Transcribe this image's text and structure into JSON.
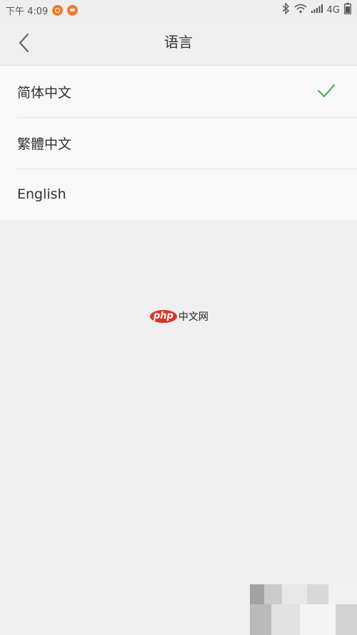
{
  "status_bar": {
    "time": "下午 4:09",
    "network": "4G",
    "icons": [
      "notification-icon",
      "chat-icon",
      "bluetooth-icon",
      "wifi-icon",
      "signal-icon"
    ]
  },
  "nav": {
    "title": "语言",
    "back_icon": "chevron-left-icon"
  },
  "languages": [
    {
      "label": "简体中文",
      "selected": true
    },
    {
      "label": "繁體中文",
      "selected": false
    },
    {
      "label": "English",
      "selected": false
    }
  ],
  "watermark": {
    "logo": "php",
    "text": "中文网"
  },
  "colors": {
    "check": "#4caf6a",
    "background": "#efefef",
    "list_background": "#f8f8f8"
  }
}
